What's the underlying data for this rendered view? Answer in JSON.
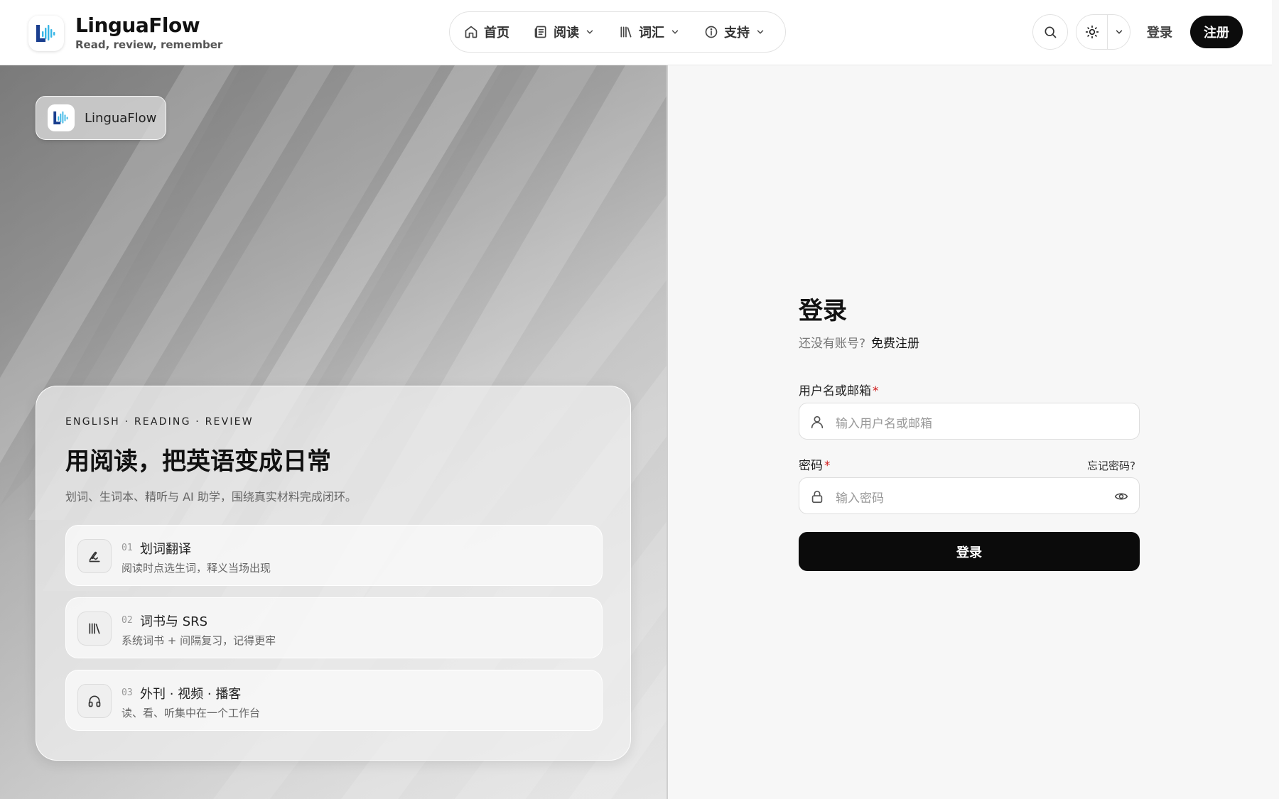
{
  "colors": {
    "accent": "#0b0b0b",
    "required": "#d01a1a",
    "logo_blue": "#1a3f8f",
    "logo_wave": "#38b6e6"
  },
  "brand": {
    "name": "LinguaFlow",
    "tagline": "Read, review, remember"
  },
  "nav": {
    "items": [
      {
        "label": "首页",
        "icon": "home-icon",
        "has_dropdown": false
      },
      {
        "label": "阅读",
        "icon": "newspaper-icon",
        "has_dropdown": true
      },
      {
        "label": "词汇",
        "icon": "library-icon",
        "has_dropdown": true
      },
      {
        "label": "支持",
        "icon": "info-icon",
        "has_dropdown": true
      }
    ]
  },
  "header": {
    "login_label": "登录",
    "register_label": "注册"
  },
  "hero": {
    "badge_name": "LinguaFlow",
    "eyebrow": "ENGLISH · READING · REVIEW",
    "title": "用阅读，把英语变成日常",
    "subtitle": "划词、生词本、精听与 AI 助学，围绕真实材料完成闭环。",
    "features": [
      {
        "num": "01",
        "title": "划词翻译",
        "desc": "阅读时点选生词，释义当场出现",
        "icon": "signature-icon"
      },
      {
        "num": "02",
        "title": "词书与 SRS",
        "desc": "系统词书 + 间隔复习，记得更牢",
        "icon": "library-icon"
      },
      {
        "num": "03",
        "title": "外刊 · 视频 · 播客",
        "desc": "读、看、听集中在一个工作台",
        "icon": "headphones-icon"
      }
    ]
  },
  "login": {
    "title": "登录",
    "no_account": "还没有账号?",
    "register_link": "免费注册",
    "username_label": "用户名或邮箱",
    "username_placeholder": "输入用户名或邮箱",
    "password_label": "密码",
    "forgot_label": "忘记密码?",
    "password_placeholder": "输入密码",
    "required_mark": "*",
    "submit_label": "登录"
  }
}
